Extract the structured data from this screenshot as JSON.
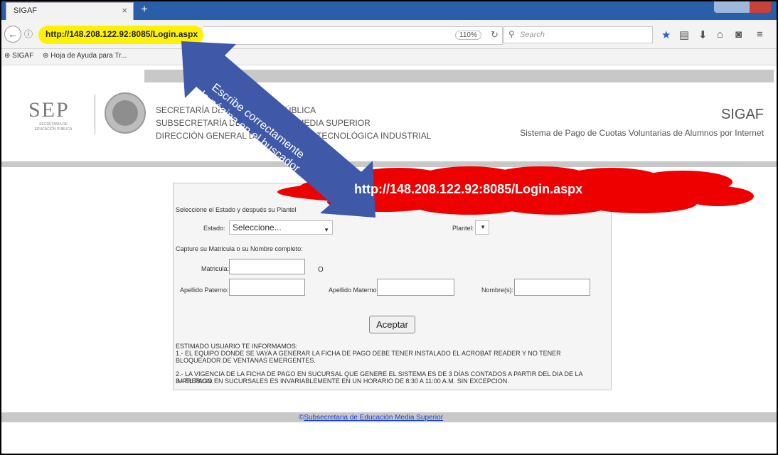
{
  "browser": {
    "tab_title": "SIGAF",
    "tab_close": "×",
    "new_tab": "+",
    "url": "http://148.208.122.92:8085/Login.aspx",
    "zoom": "110%",
    "search_placeholder": "Search",
    "bookmarks": [
      "SIGAF",
      "Hoja de Ayuda para Tr..."
    ]
  },
  "header": {
    "sep_logo": "SEP",
    "sep_subtitle": "SECRETARÍA DE EDUCACIÓN PÚBLICA",
    "institution_lines": [
      "SECRETARÍA DE EDUCACIÓN PÚBLICA",
      "SUBSECRETARÍA DE EDUCACIÓN MEDIA SUPERIOR",
      "DIRECCIÓN GENERAL DE EDUCACIÓN TECNOLÓGICA INDUSTRIAL"
    ],
    "app_title": "SIGAF",
    "app_subtitle": "Sistema de Pago de Cuotas Voluntarias de Alumnos por Internet"
  },
  "form": {
    "intro": "Seleccione el Estado y después su Plantel",
    "estado_label": "Estado:",
    "estado_value": "Seleccione...",
    "plantel_label": "Plantel:",
    "capture_label": "Capture su Matricula o su Nombre completo:",
    "matricula_label": "Matricula:",
    "or_text": "O",
    "ap_paterno_label": "Apellido Paterno:",
    "ap_materno_label": "Apellido Materno:",
    "nombre_label": "Nombre(s):",
    "submit_label": "Aceptar",
    "notice_title": "ESTIMADO USUARIO TE INFORMAMOS:",
    "notice_lines": [
      "1.- EL EQUIPO DONDE SE VAYA A GENERAR LA FICHA DE PAGO DEBE TENER INSTALADO EL ACROBAT READER Y NO TENER BLOQUEADOR DE VENTANAS EMERGENTES.",
      "2.- LA VIGENCIA DE LA FICHA DE PAGO EN SUCURSAL QUE GENERE EL SISTEMA ES DE 3 DÍAS CONTADOS A PARTIR DEL DIA DE LA IMPRESION.",
      "3.- EL PAGO EN SUCURSALES ES INVARIABLEMENTE EN UN HORARIO DE 8:30 A 11:00 A.M. SIN EXCEPCION."
    ]
  },
  "footer": {
    "copyright": "©",
    "link": "Subsecretaria de Educación Media Superior"
  },
  "annotations": {
    "arrow_line1": "Escribe correctamente",
    "arrow_line2": "la página en el buscador",
    "cloud_url": "http://148.208.122.92:8085/Login.aspx"
  },
  "colors": {
    "highlight": "#fff200",
    "arrow": "#3f58a8",
    "cloud": "#ee0000",
    "link": "#1a3fcf"
  }
}
